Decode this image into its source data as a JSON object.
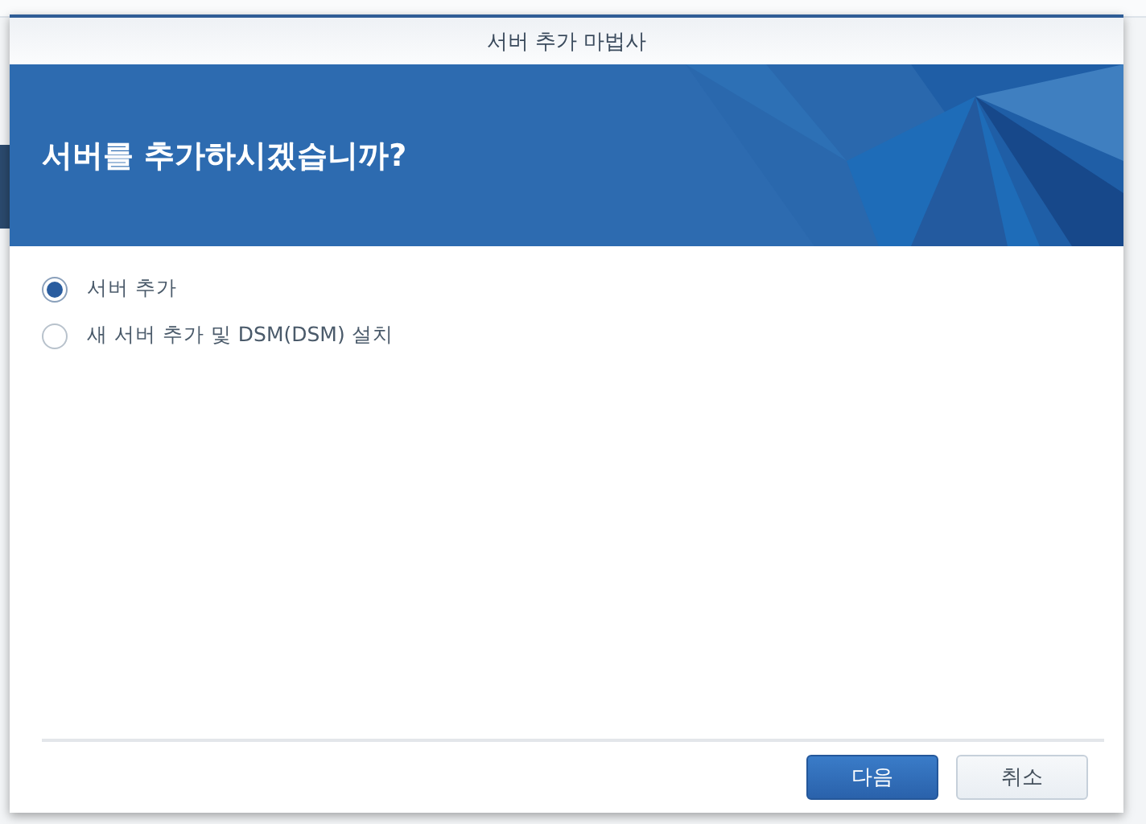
{
  "window": {
    "title": "서버 추가 마법사"
  },
  "banner": {
    "heading": "서버를 추가하시겠습니까?"
  },
  "options": [
    {
      "label": "서버 추가",
      "selected": true
    },
    {
      "label": "새 서버 추가 및 DSM(DSM) 설치",
      "selected": false
    }
  ],
  "buttons": [
    {
      "label": "다음",
      "kind": "primary"
    },
    {
      "label": "취소",
      "kind": "secondary"
    }
  ]
}
